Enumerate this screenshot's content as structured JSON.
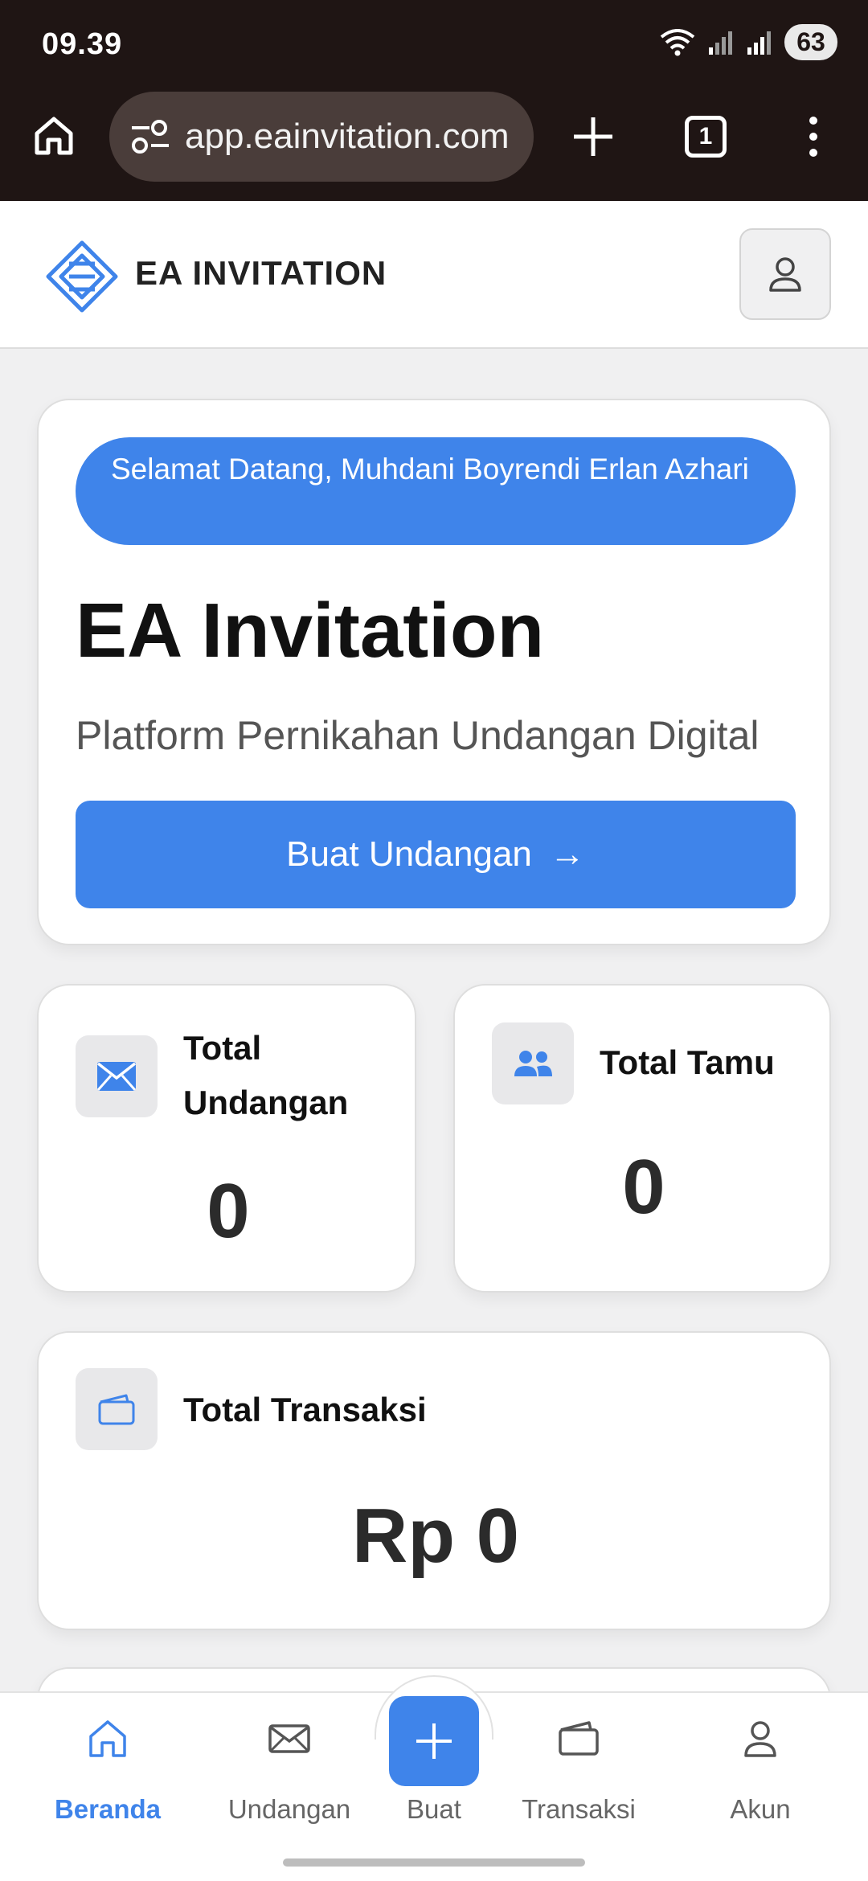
{
  "status_bar": {
    "time": "09.39",
    "battery": "63"
  },
  "browser": {
    "url": "app.eainvitation.com",
    "tab_count": "1"
  },
  "header": {
    "logo_text": "EA INVITATION"
  },
  "hero": {
    "welcome": "Selamat Datang, Muhdani Boyrendi Erlan Azhari",
    "title": "EA Invitation",
    "subtitle": "Platform Pernikahan Undangan Digital",
    "cta_label": "Buat Undangan",
    "cta_arrow": "→"
  },
  "stats": {
    "undangan": {
      "label": "Total Undangan",
      "value": "0"
    },
    "tamu": {
      "label": "Total Tamu",
      "value": "0"
    },
    "transaksi": {
      "label": "Total Transaksi",
      "value": "Rp 0"
    }
  },
  "bottom_nav": {
    "beranda": "Beranda",
    "undangan": "Undangan",
    "buat": "Buat",
    "transaksi": "Transaksi",
    "akun": "Akun"
  },
  "colors": {
    "accent": "#3f84ea",
    "chrome": "#1f1514"
  },
  "icons": [
    "home-icon",
    "tune-icon",
    "plus-icon",
    "tabs-icon",
    "more-vert-icon",
    "profile-icon",
    "envelope-icon",
    "users-icon",
    "wallet-icon"
  ]
}
